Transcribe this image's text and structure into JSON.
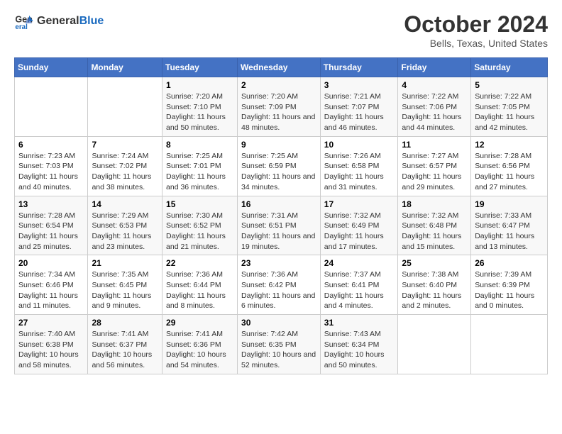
{
  "logo": {
    "line1": "General",
    "line2": "Blue"
  },
  "title": "October 2024",
  "subtitle": "Bells, Texas, United States",
  "weekdays": [
    "Sunday",
    "Monday",
    "Tuesday",
    "Wednesday",
    "Thursday",
    "Friday",
    "Saturday"
  ],
  "weeks": [
    [
      {
        "day": "",
        "info": ""
      },
      {
        "day": "",
        "info": ""
      },
      {
        "day": "1",
        "info": "Sunrise: 7:20 AM\nSunset: 7:10 PM\nDaylight: 11 hours and 50 minutes."
      },
      {
        "day": "2",
        "info": "Sunrise: 7:20 AM\nSunset: 7:09 PM\nDaylight: 11 hours and 48 minutes."
      },
      {
        "day": "3",
        "info": "Sunrise: 7:21 AM\nSunset: 7:07 PM\nDaylight: 11 hours and 46 minutes."
      },
      {
        "day": "4",
        "info": "Sunrise: 7:22 AM\nSunset: 7:06 PM\nDaylight: 11 hours and 44 minutes."
      },
      {
        "day": "5",
        "info": "Sunrise: 7:22 AM\nSunset: 7:05 PM\nDaylight: 11 hours and 42 minutes."
      }
    ],
    [
      {
        "day": "6",
        "info": "Sunrise: 7:23 AM\nSunset: 7:03 PM\nDaylight: 11 hours and 40 minutes."
      },
      {
        "day": "7",
        "info": "Sunrise: 7:24 AM\nSunset: 7:02 PM\nDaylight: 11 hours and 38 minutes."
      },
      {
        "day": "8",
        "info": "Sunrise: 7:25 AM\nSunset: 7:01 PM\nDaylight: 11 hours and 36 minutes."
      },
      {
        "day": "9",
        "info": "Sunrise: 7:25 AM\nSunset: 6:59 PM\nDaylight: 11 hours and 34 minutes."
      },
      {
        "day": "10",
        "info": "Sunrise: 7:26 AM\nSunset: 6:58 PM\nDaylight: 11 hours and 31 minutes."
      },
      {
        "day": "11",
        "info": "Sunrise: 7:27 AM\nSunset: 6:57 PM\nDaylight: 11 hours and 29 minutes."
      },
      {
        "day": "12",
        "info": "Sunrise: 7:28 AM\nSunset: 6:56 PM\nDaylight: 11 hours and 27 minutes."
      }
    ],
    [
      {
        "day": "13",
        "info": "Sunrise: 7:28 AM\nSunset: 6:54 PM\nDaylight: 11 hours and 25 minutes."
      },
      {
        "day": "14",
        "info": "Sunrise: 7:29 AM\nSunset: 6:53 PM\nDaylight: 11 hours and 23 minutes."
      },
      {
        "day": "15",
        "info": "Sunrise: 7:30 AM\nSunset: 6:52 PM\nDaylight: 11 hours and 21 minutes."
      },
      {
        "day": "16",
        "info": "Sunrise: 7:31 AM\nSunset: 6:51 PM\nDaylight: 11 hours and 19 minutes."
      },
      {
        "day": "17",
        "info": "Sunrise: 7:32 AM\nSunset: 6:49 PM\nDaylight: 11 hours and 17 minutes."
      },
      {
        "day": "18",
        "info": "Sunrise: 7:32 AM\nSunset: 6:48 PM\nDaylight: 11 hours and 15 minutes."
      },
      {
        "day": "19",
        "info": "Sunrise: 7:33 AM\nSunset: 6:47 PM\nDaylight: 11 hours and 13 minutes."
      }
    ],
    [
      {
        "day": "20",
        "info": "Sunrise: 7:34 AM\nSunset: 6:46 PM\nDaylight: 11 hours and 11 minutes."
      },
      {
        "day": "21",
        "info": "Sunrise: 7:35 AM\nSunset: 6:45 PM\nDaylight: 11 hours and 9 minutes."
      },
      {
        "day": "22",
        "info": "Sunrise: 7:36 AM\nSunset: 6:44 PM\nDaylight: 11 hours and 8 minutes."
      },
      {
        "day": "23",
        "info": "Sunrise: 7:36 AM\nSunset: 6:42 PM\nDaylight: 11 hours and 6 minutes."
      },
      {
        "day": "24",
        "info": "Sunrise: 7:37 AM\nSunset: 6:41 PM\nDaylight: 11 hours and 4 minutes."
      },
      {
        "day": "25",
        "info": "Sunrise: 7:38 AM\nSunset: 6:40 PM\nDaylight: 11 hours and 2 minutes."
      },
      {
        "day": "26",
        "info": "Sunrise: 7:39 AM\nSunset: 6:39 PM\nDaylight: 11 hours and 0 minutes."
      }
    ],
    [
      {
        "day": "27",
        "info": "Sunrise: 7:40 AM\nSunset: 6:38 PM\nDaylight: 10 hours and 58 minutes."
      },
      {
        "day": "28",
        "info": "Sunrise: 7:41 AM\nSunset: 6:37 PM\nDaylight: 10 hours and 56 minutes."
      },
      {
        "day": "29",
        "info": "Sunrise: 7:41 AM\nSunset: 6:36 PM\nDaylight: 10 hours and 54 minutes."
      },
      {
        "day": "30",
        "info": "Sunrise: 7:42 AM\nSunset: 6:35 PM\nDaylight: 10 hours and 52 minutes."
      },
      {
        "day": "31",
        "info": "Sunrise: 7:43 AM\nSunset: 6:34 PM\nDaylight: 10 hours and 50 minutes."
      },
      {
        "day": "",
        "info": ""
      },
      {
        "day": "",
        "info": ""
      }
    ]
  ]
}
